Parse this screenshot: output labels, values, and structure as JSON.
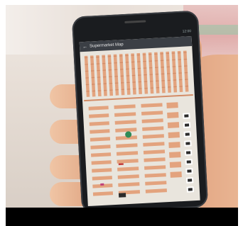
{
  "app": {
    "title": "Supermarket Map",
    "back_icon": "arrow-left-icon",
    "status_text": "12:00"
  },
  "colors": {
    "map_background": "#e9e5dd",
    "aisle_block": "#e3a37e",
    "shelf_stripe": "#d38c67",
    "app_bar": "#3b3f45",
    "location_marker": "#2e8b57",
    "checkout": "#2b2b2b"
  },
  "map": {
    "legend_icons": [
      "checkout-icon",
      "location-marker-icon"
    ]
  }
}
